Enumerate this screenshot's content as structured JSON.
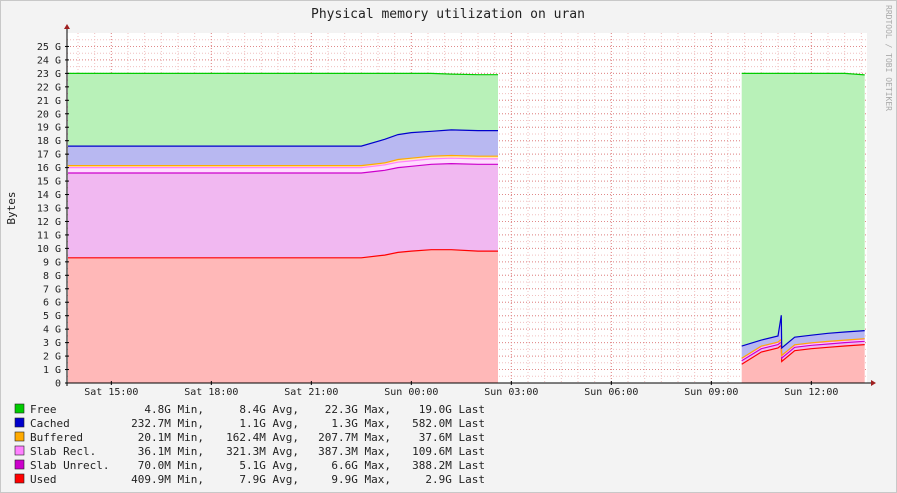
{
  "chart_data": {
    "type": "area",
    "title": "Physical memory utilization on uran",
    "ylabel": "Bytes",
    "watermark": "RRDTOOL / TOBI OETIKER",
    "ylim": [
      0,
      26
    ],
    "y_unit": "G",
    "y_ticks": [
      0,
      1,
      2,
      3,
      4,
      5,
      6,
      7,
      8,
      9,
      10,
      11,
      12,
      13,
      14,
      15,
      16,
      17,
      18,
      19,
      20,
      21,
      22,
      23,
      24,
      25
    ],
    "xlim_hours": [
      13.67,
      37.67
    ],
    "x_ticks": [
      {
        "label": "Sat 15:00",
        "hour": 15
      },
      {
        "label": "Sat 18:00",
        "hour": 18
      },
      {
        "label": "Sat 21:00",
        "hour": 21
      },
      {
        "label": "Sun 00:00",
        "hour": 24
      },
      {
        "label": "Sun 03:00",
        "hour": 27
      },
      {
        "label": "Sun 06:00",
        "hour": 30
      },
      {
        "label": "Sun 09:00",
        "hour": 33
      },
      {
        "label": "Sun 12:00",
        "hour": 36
      }
    ],
    "stack_order": [
      "Used",
      "Slab Unrecl.",
      "Slab Recl.",
      "Buffered",
      "Cached",
      "Free"
    ],
    "x": [
      13.7,
      15.5,
      18.0,
      20.0,
      21.5,
      22.5,
      23.2,
      23.6,
      24.0,
      24.6,
      25.2,
      26.0,
      26.6,
      26.61,
      33.9,
      33.91,
      34.5,
      35.0,
      35.1,
      35.11,
      35.5,
      36.0,
      36.5,
      37.0,
      37.6
    ],
    "series": [
      {
        "name": "Used",
        "color": "#ff0000",
        "values": [
          9.3,
          9.3,
          9.3,
          9.3,
          9.3,
          9.3,
          9.5,
          9.7,
          9.8,
          9.9,
          9.9,
          9.8,
          9.8,
          null,
          null,
          1.4,
          2.3,
          2.6,
          2.8,
          1.6,
          2.4,
          2.55,
          2.65,
          2.75,
          2.85
        ]
      },
      {
        "name": "Slab Unrecl.",
        "color": "#cc00cc",
        "values": [
          6.3,
          6.3,
          6.3,
          6.3,
          6.3,
          6.3,
          6.3,
          6.3,
          6.3,
          6.35,
          6.4,
          6.45,
          6.45,
          null,
          null,
          0.25,
          0.25,
          0.25,
          0.25,
          0.25,
          0.25,
          0.25,
          0.25,
          0.25,
          0.25
        ]
      },
      {
        "name": "Slab Recl.",
        "color": "#ff80ff",
        "values": [
          0.4,
          0.4,
          0.4,
          0.4,
          0.4,
          0.4,
          0.4,
          0.4,
          0.4,
          0.4,
          0.4,
          0.4,
          0.4,
          null,
          null,
          0.15,
          0.15,
          0.15,
          0.15,
          0.15,
          0.15,
          0.15,
          0.15,
          0.15,
          0.15
        ]
      },
      {
        "name": "Buffered",
        "color": "#ffaa00",
        "values": [
          0.15,
          0.15,
          0.15,
          0.15,
          0.15,
          0.15,
          0.15,
          0.2,
          0.2,
          0.2,
          0.2,
          0.2,
          0.2,
          null,
          null,
          0.04,
          0.04,
          0.04,
          0.04,
          0.04,
          0.04,
          0.04,
          0.04,
          0.04,
          0.04
        ]
      },
      {
        "name": "Cached",
        "color": "#0000cc",
        "values": [
          1.45,
          1.45,
          1.45,
          1.45,
          1.45,
          1.45,
          1.75,
          1.85,
          1.9,
          1.85,
          1.9,
          1.9,
          1.9,
          null,
          null,
          0.9,
          0.45,
          0.45,
          1.8,
          0.56,
          0.56,
          0.56,
          0.6,
          0.6,
          0.6
        ]
      },
      {
        "name": "Free",
        "color": "#00cc00",
        "values": [
          5.4,
          5.4,
          5.4,
          5.4,
          5.4,
          5.4,
          4.9,
          4.55,
          4.4,
          4.3,
          4.15,
          4.15,
          4.15,
          null,
          null,
          20.26,
          19.81,
          19.51,
          17.96,
          20.4,
          19.6,
          19.45,
          19.31,
          19.21,
          19.0
        ]
      }
    ],
    "legend": [
      {
        "name": "Free",
        "color": "#00cc00",
        "min": "4.8G Min,",
        "avg": "8.4G Avg,",
        "max": "22.3G Max,",
        "last": "19.0G Last"
      },
      {
        "name": "Cached",
        "color": "#0000cc",
        "min": "232.7M Min,",
        "avg": "1.1G Avg,",
        "max": "1.3G Max,",
        "last": "582.0M Last"
      },
      {
        "name": "Buffered",
        "color": "#ffaa00",
        "min": "20.1M Min,",
        "avg": "162.4M Avg,",
        "max": "207.7M Max,",
        "last": "37.6M Last"
      },
      {
        "name": "Slab Recl.",
        "color": "#ff80ff",
        "min": "36.1M Min,",
        "avg": "321.3M Avg,",
        "max": "387.3M Max,",
        "last": "109.6M Last"
      },
      {
        "name": "Slab Unrecl.",
        "color": "#cc00cc",
        "min": "70.0M Min,",
        "avg": "5.1G Avg,",
        "max": "6.6G Max,",
        "last": "388.2M Last"
      },
      {
        "name": "Used",
        "color": "#ff0000",
        "min": "409.9M Min,",
        "avg": "7.9G Avg,",
        "max": "9.9G Max,",
        "last": "2.9G Last"
      }
    ],
    "grid": true,
    "legend_position": "bottom-left"
  }
}
